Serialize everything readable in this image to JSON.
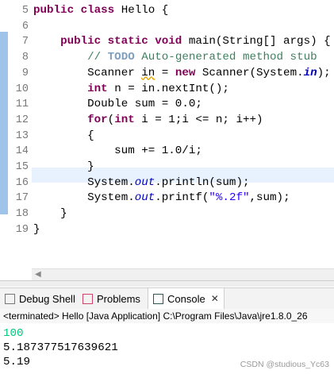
{
  "editor": {
    "line_numbers": [
      "5",
      "6",
      "7",
      "8",
      "9",
      "10",
      "11",
      "12",
      "13",
      "14",
      "15",
      "16",
      "17",
      "18",
      "19"
    ],
    "code": {
      "l5_kw": "public class ",
      "l5_rest": "Hello {",
      "l7_kw1": "public static void ",
      "l7_rest": "main(String[] args) {",
      "l8_c1": "// ",
      "l8_tag": "TODO",
      "l8_c2": " Auto-generated method stub",
      "l9_a": "Scanner ",
      "l9_b": "in",
      "l9_c": " = ",
      "l9_kw": "new ",
      "l9_d": "Scanner(System.",
      "l9_field": "in",
      "l9_e": ");",
      "l10_kw": "int ",
      "l10_rest": "n = in.nextInt();",
      "l11": "Double sum = 0.0;",
      "l12_kw1": "for",
      "l12_a": "(",
      "l12_kw2": "int ",
      "l12_b": "i = 1;i <= n; i++)",
      "l13": "{",
      "l14": "sum += 1.0/i;",
      "l15": "}",
      "l16_a": "System.",
      "l16_field": "out",
      "l16_b": ".println(sum);",
      "l17_a": "System.",
      "l17_field": "out",
      "l17_b": ".printf(",
      "l17_str": "\"%.2f\"",
      "l17_c": ",sum);",
      "l18": "}",
      "l19": "}"
    }
  },
  "tabs": {
    "debug_shell": "Debug Shell",
    "problems": "Problems",
    "console": "Console",
    "close": "✕"
  },
  "console": {
    "header": "<terminated> Hello [Java Application] C:\\Program Files\\Java\\jre1.8.0_26",
    "input": "100",
    "out1": "5.187377517639621",
    "out2": "5.19",
    "watermark": "CSDN @studious_Yc63"
  }
}
